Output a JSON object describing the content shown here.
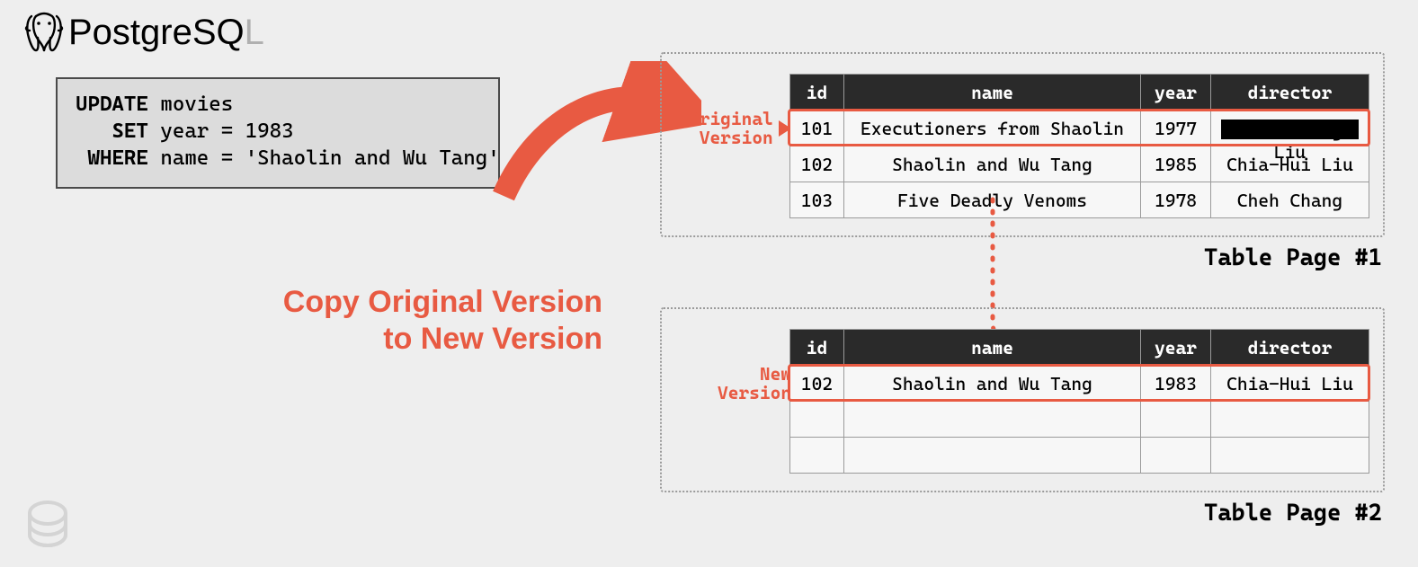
{
  "logo": {
    "text": "PostgreSQL"
  },
  "sql": {
    "kw_update": "UPDATE",
    "table": "movies",
    "kw_set": "SET",
    "set_expr": "year = 1983",
    "kw_where": "WHERE",
    "where_expr": "name = 'Shaolin and Wu Tang'"
  },
  "headline_line1": "Copy Original Version",
  "headline_line2": "to New Version",
  "labels": {
    "original": "Original\nVersion",
    "new": "New\nVersion"
  },
  "captions": {
    "page1": "Table Page #1",
    "page2": "Table Page #2"
  },
  "columns": {
    "id": "id",
    "name": "name",
    "year": "year",
    "director": "director"
  },
  "page1_rows": [
    {
      "id": "101",
      "name": "Executioners from Shaolin",
      "year": "1977",
      "director": "Chia-Liang Liu",
      "redacted": true
    },
    {
      "id": "102",
      "name": "Shaolin and Wu Tang",
      "year": "1985",
      "director": "Chia-Hui Liu"
    },
    {
      "id": "103",
      "name": "Five Deadly Venoms",
      "year": "1978",
      "director": "Cheh Chang"
    }
  ],
  "page2_rows": [
    {
      "id": "102",
      "name": "Shaolin and Wu Tang",
      "year": "1983",
      "director": "Chia-Hui Liu"
    },
    {
      "id": "",
      "name": "",
      "year": "",
      "director": ""
    },
    {
      "id": "",
      "name": "",
      "year": "",
      "director": ""
    }
  ],
  "colors": {
    "accent": "#e85a42"
  }
}
